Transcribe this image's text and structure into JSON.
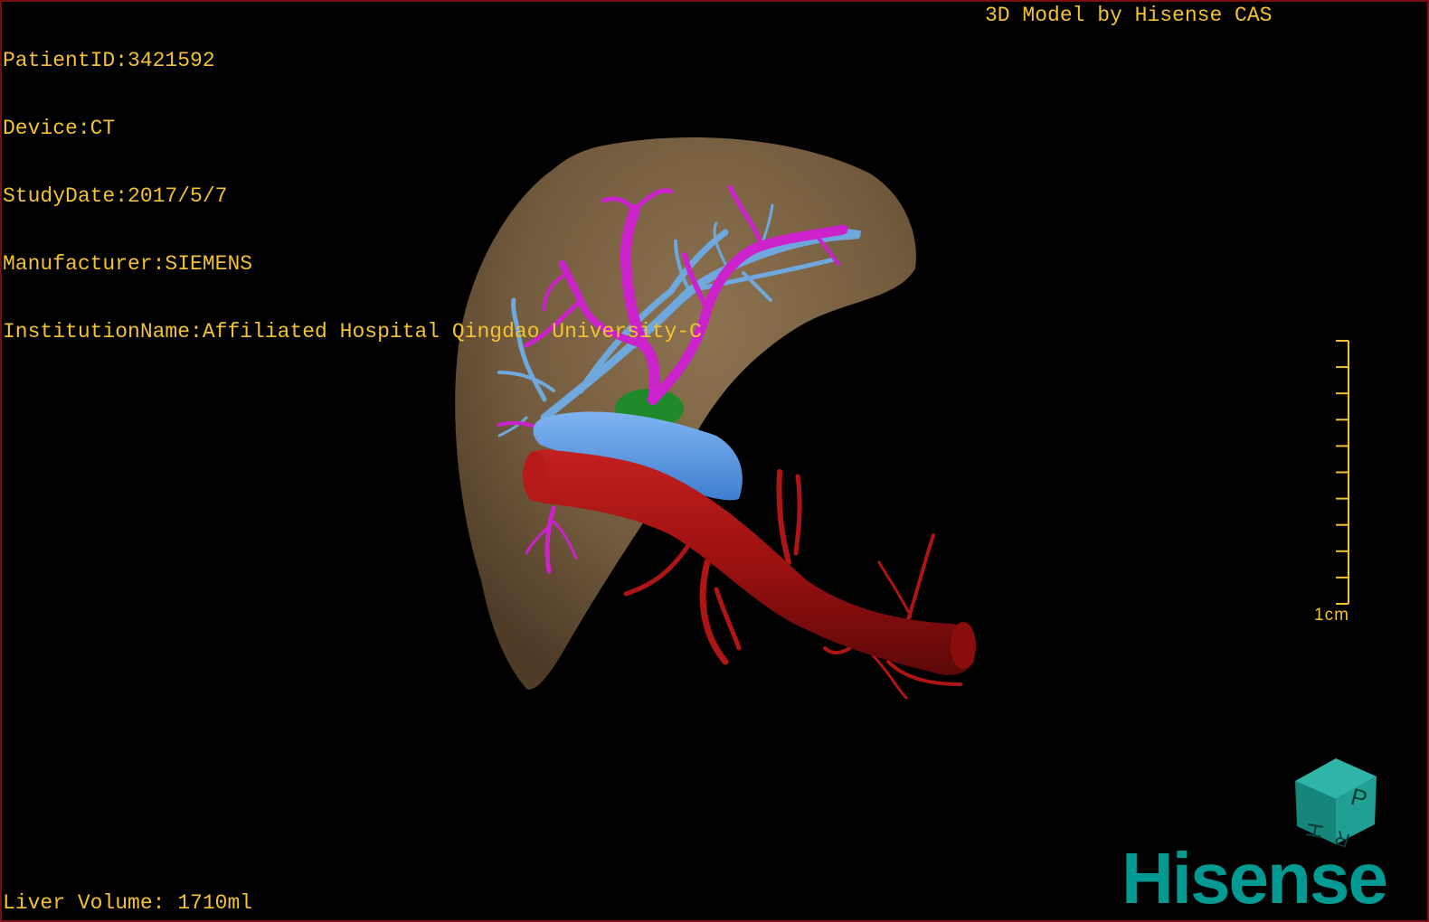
{
  "study_info": {
    "patient_id": "PatientID:3421592",
    "device": "Device:CT",
    "study_date": "StudyDate:2017/5/7",
    "manufacturer": "Manufacturer:SIEMENS",
    "institution": "InstitutionName:Affiliated Hospital Qingdao University-C"
  },
  "model_credit": "3D Model by Hisense CAS",
  "liver_volume": "Liver Volume: 1710ml",
  "scale": {
    "label": "1cm",
    "tick_count": 11
  },
  "orientation_cube": {
    "visible_faces": [
      "P",
      "H",
      "R"
    ]
  },
  "brand": {
    "name": "Hisense",
    "color": "#009a93"
  },
  "colors": {
    "hud_text": "#f2c230",
    "liver": "#7a6244",
    "portal_vein": "#cc22cc",
    "hepatic_vein": "#6fa8dc",
    "ivc": "#4a8ee0",
    "aorta": "#a51212",
    "gallbladder": "#1f8a2a",
    "border": "#7a0f12"
  },
  "structures": [
    "liver",
    "portal-vein",
    "hepatic-vein",
    "inferior-vena-cava",
    "aorta",
    "gallbladder"
  ]
}
